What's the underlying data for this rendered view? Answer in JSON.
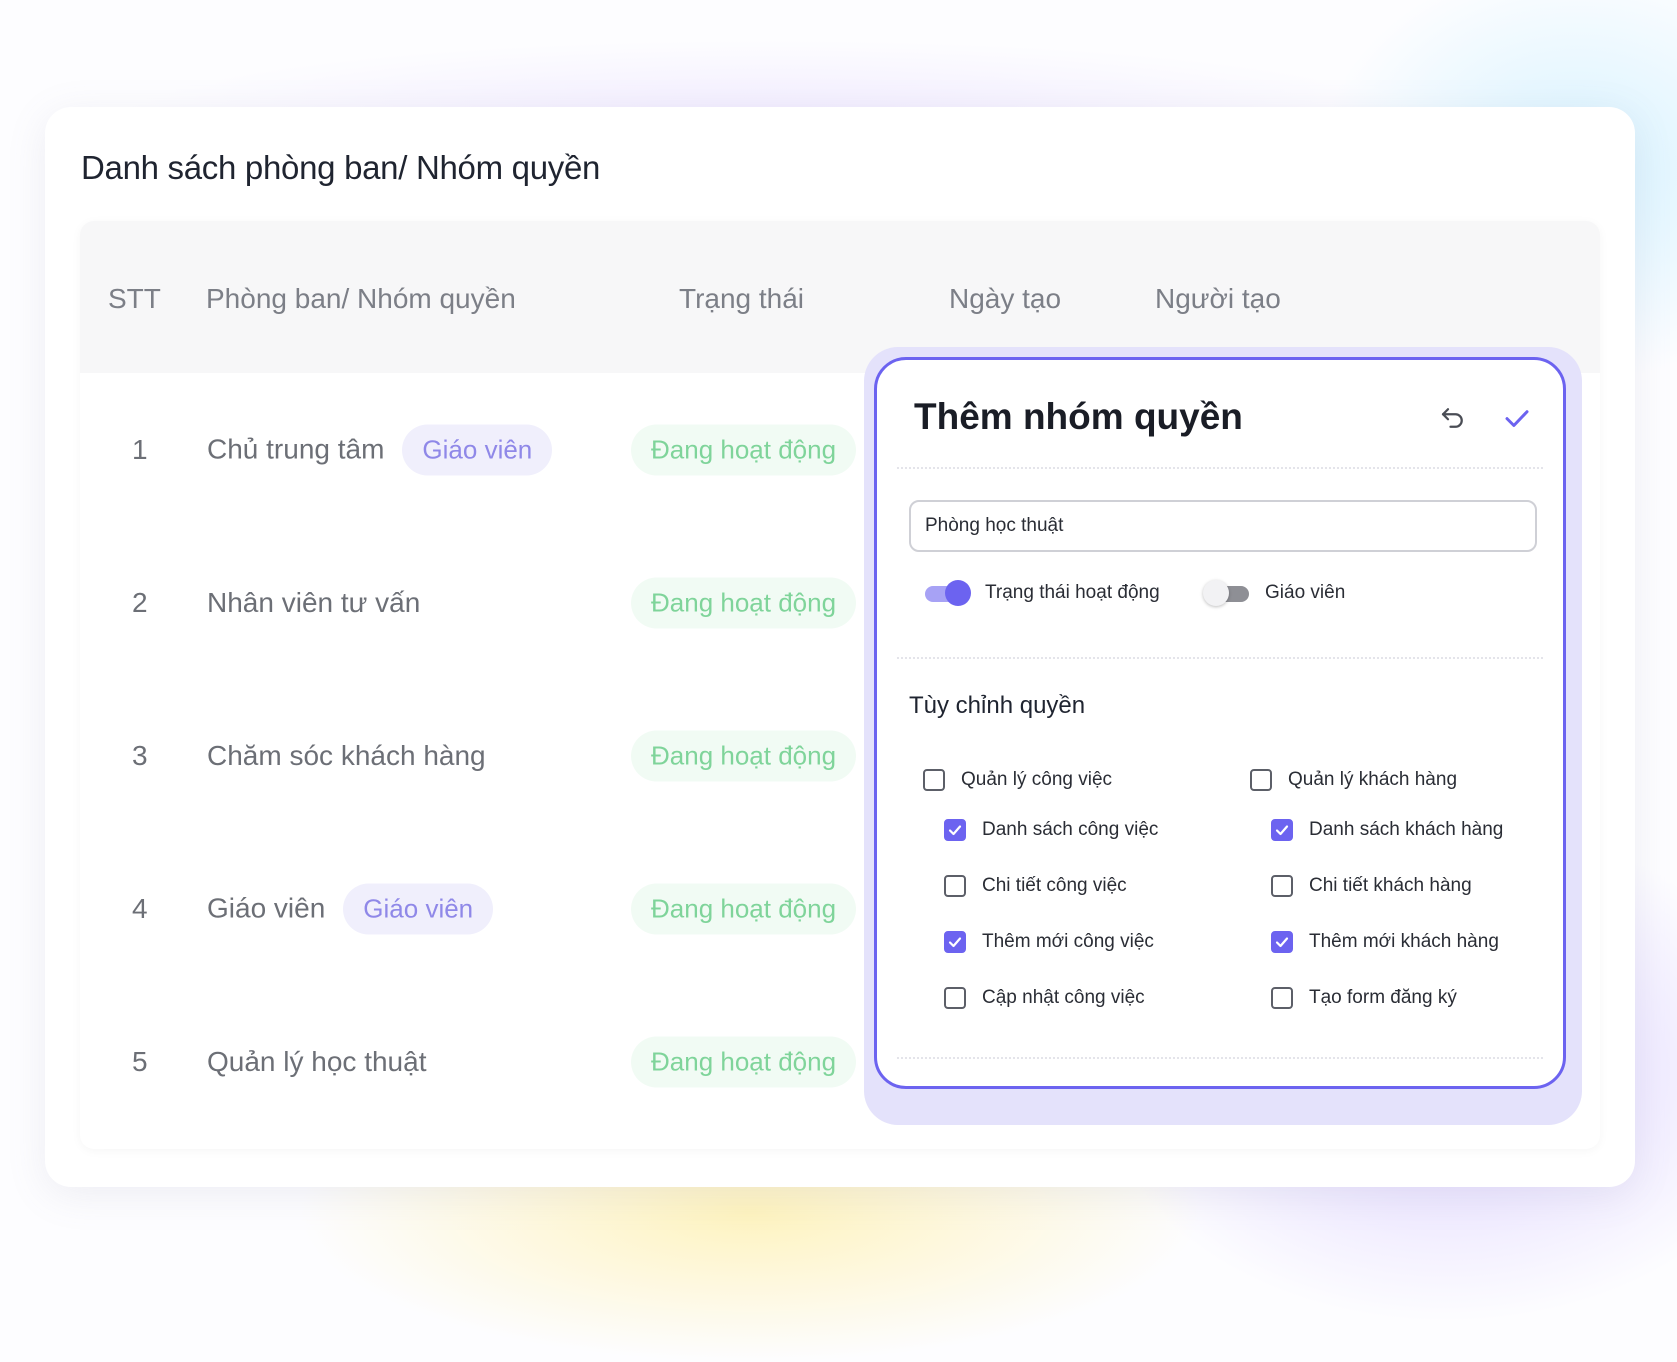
{
  "page": {
    "title": "Danh sách phòng ban/ Nhóm quyền"
  },
  "table": {
    "headers": {
      "stt": "STT",
      "name": "Phòng ban/ Nhóm quyền",
      "status": "Trạng thái",
      "created_date": "Ngày tạo",
      "created_by": "Người tạo"
    },
    "rows": [
      {
        "stt": "1",
        "name": "Chủ trung tâm",
        "tag": "Giáo viên",
        "status": "Đang hoạt động"
      },
      {
        "stt": "2",
        "name": "Nhân viên tư vấn",
        "tag": "",
        "status": "Đang hoạt động"
      },
      {
        "stt": "3",
        "name": "Chăm sóc khách hàng",
        "tag": "",
        "status": "Đang hoạt động"
      },
      {
        "stt": "4",
        "name": "Giáo viên",
        "tag": "Giáo viên",
        "status": "Đang hoạt động"
      },
      {
        "stt": "5",
        "name": "Quản lý học thuật",
        "tag": "",
        "status": "Đang hoạt động"
      }
    ]
  },
  "modal": {
    "title": "Thêm nhóm quyền",
    "undo_icon": "undo-icon",
    "confirm_icon": "check-icon",
    "name_input_value": "Phòng học thuật",
    "toggles": [
      {
        "label": "Trạng thái hoạt động",
        "on": true
      },
      {
        "label": "Giáo viên",
        "on": false
      }
    ],
    "section_title": "Tùy chỉnh quyền",
    "groups": [
      {
        "label": "Quản lý công việc",
        "checked": false,
        "items": [
          {
            "label": "Danh sách công việc",
            "checked": true
          },
          {
            "label": "Chi tiết công việc",
            "checked": false
          },
          {
            "label": "Thêm mới công việc",
            "checked": true
          },
          {
            "label": "Cập nhật công việc",
            "checked": false
          }
        ]
      },
      {
        "label": "Quản lý khách hàng",
        "checked": false,
        "items": [
          {
            "label": "Danh sách khách hàng",
            "checked": true
          },
          {
            "label": "Chi tiết khách hàng",
            "checked": false
          },
          {
            "label": "Thêm mới khách hàng",
            "checked": true
          },
          {
            "label": "Tạo form đăng ký",
            "checked": false
          }
        ]
      }
    ]
  },
  "colors": {
    "accent": "#6c63f0",
    "status_text": "#7fd49a",
    "status_bg": "#f1fbf4",
    "tag_text": "#8f88e8",
    "tag_bg": "#f0effc"
  }
}
